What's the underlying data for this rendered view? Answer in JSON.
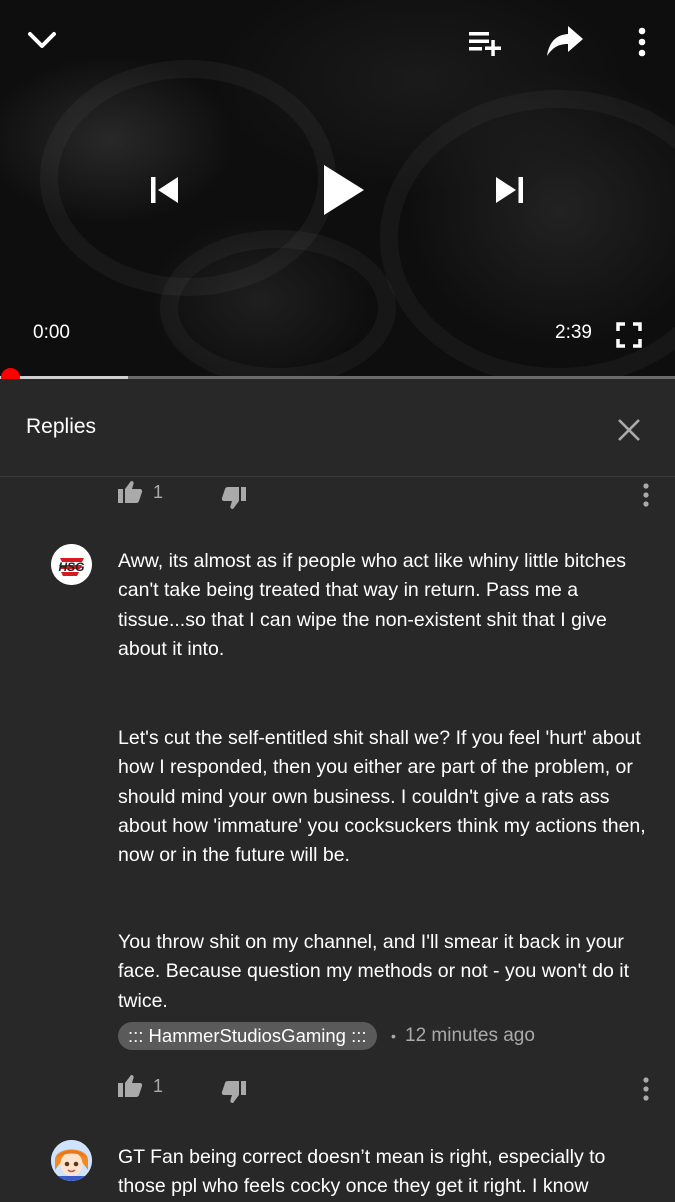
{
  "player": {
    "current_time": "0:00",
    "duration": "2:39",
    "progress": 0.0,
    "buffered": 0.19,
    "icons": {
      "collapse": "chevron-down-icon",
      "add_to_queue": "playlist-add-icon",
      "share": "share-icon",
      "more": "more-vertical-icon",
      "previous": "skip-previous-icon",
      "play": "play-icon",
      "next": "skip-next-icon",
      "fullscreen": "fullscreen-icon"
    },
    "accent_color": "#ff0000"
  },
  "replies_panel": {
    "title": "Replies",
    "close_icon": "close-icon"
  },
  "comments": [
    {
      "likes": "1"
    },
    {
      "avatar": "hsg-logo",
      "paragraphs": [
        "Aww, its almost as if people who act like whiny little bitches can't take being treated that way in return. Pass me a tissue...so that I can wipe the non-existent shit that I give about it into.",
        "Let's cut the self-entitled shit shall we? If you feel 'hurt' about how I responded, then you either are part of the problem, or should mind your own business. I couldn't give a rats ass about how 'immature' you cocksuckers think my actions then, now or in the future will be.",
        "You throw shit on my channel, and I'll smear it back in your face. Because question my methods or not - you won't do it twice."
      ],
      "author": "::: HammerStudiosGaming :::",
      "separator": "•",
      "timestamp": "12 minutes ago",
      "likes": "1"
    },
    {
      "avatar": "anime-avatar",
      "text_visible": "GT Fan being correct doesn’t mean is right, especially to those ppl who feels cocky once they get it right. I know"
    }
  ]
}
